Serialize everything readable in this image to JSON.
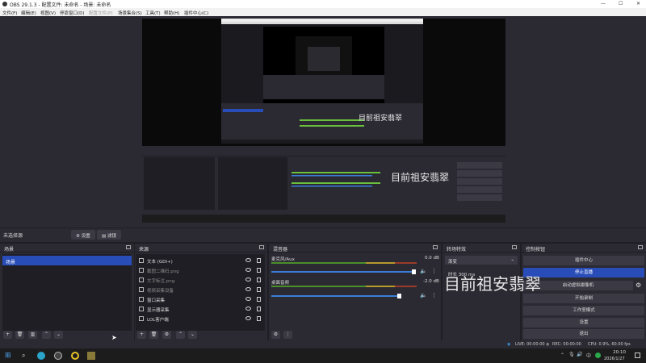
{
  "window": {
    "title": "OBS 29.1.3 - 配置文件: 未命名 - 场景: 未命名"
  },
  "menu": [
    "文件(F)",
    "编辑(E)",
    "视图(V)",
    "停靠窗口(D)",
    "配置文件(P)",
    "场景集合(S)",
    "工具(T)",
    "帮助(H)",
    "插件中心(C)"
  ],
  "scene_info": {
    "label": "未选择源",
    "settings_btn": "设置",
    "filters_btn": "滤镜"
  },
  "scenes": {
    "title": "场景",
    "items": [
      "场景"
    ]
  },
  "sources": {
    "title": "来源",
    "items": [
      "文本 (GDI+)",
      "截图二维码.png",
      "文字标注.png",
      "视频采集设备",
      "窗口采集",
      "显示器采集",
      "LOL客户端"
    ]
  },
  "mixer": {
    "title": "混音器",
    "channels": [
      {
        "name": "麦克风/Aux",
        "db": "0.0 dB"
      },
      {
        "name": "桌面音频",
        "db": "-2.0 dB"
      }
    ]
  },
  "transitions": {
    "title": "转场特效",
    "type": "渐变",
    "duration_label": "时长",
    "duration": "300 ms"
  },
  "controls": {
    "title": "控制按钮",
    "buttons": [
      "插件中心",
      "停止直播",
      "启动虚拟摄像机",
      "开始录制",
      "工作室模式",
      "设置",
      "退出"
    ]
  },
  "watermark": "目前祖安翡翠",
  "status": {
    "live": "LIVE: 00:00:00",
    "rec": "REC: 00:00:00",
    "cpu": "CPU: 0.9%, 60.00 fps"
  },
  "taskbar": {
    "time": "20:10",
    "date": "2026/1/27"
  },
  "colors": {
    "accent": "#284cb8",
    "panel": "#2b2a33",
    "bg": "#1f1e24"
  }
}
